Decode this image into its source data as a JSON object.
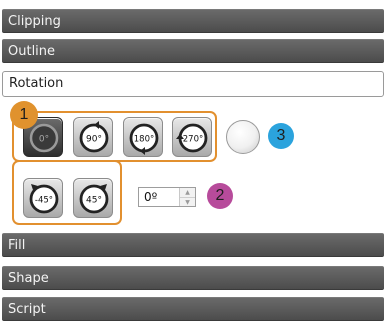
{
  "panels": {
    "clipping": "Clipping",
    "outline": "Outline",
    "rotation": "Rotation",
    "fill": "Fill",
    "shape": "Shape",
    "script": "Script"
  },
  "rotation": {
    "buttons": [
      "0°",
      "90°",
      "180°",
      "270°",
      "-45°",
      "45°"
    ],
    "selected": "0°",
    "angle_value": "0º"
  },
  "callouts": {
    "one": "1",
    "two": "2",
    "three": "3"
  },
  "colors": {
    "callout_1": "#e0922e",
    "callout_2": "#b74b9b",
    "callout_3": "#2ba3dd",
    "group_border": "#e2902f"
  }
}
